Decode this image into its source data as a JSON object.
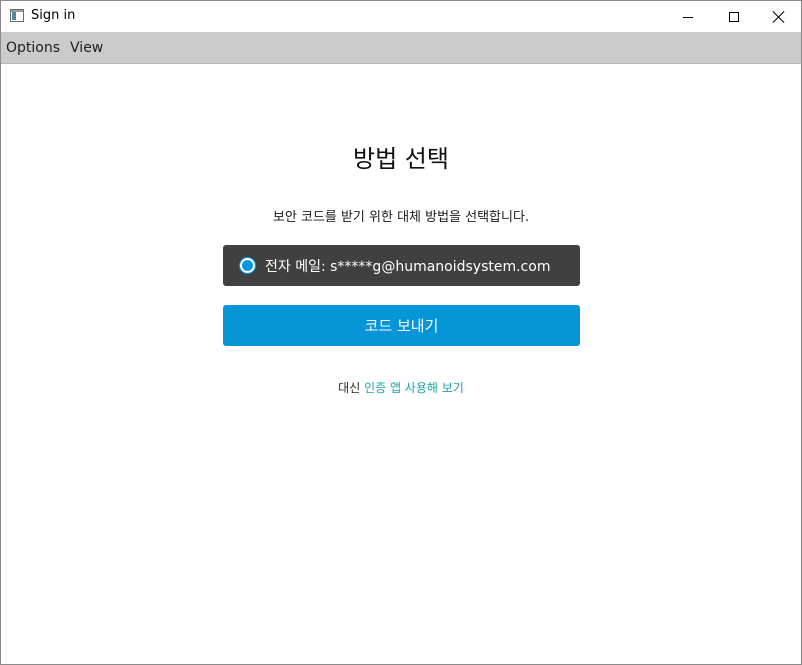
{
  "window": {
    "title": "Sign in",
    "icon": "app-window-icon",
    "controls": [
      "minimize-icon",
      "maximize-icon",
      "close-icon"
    ]
  },
  "menubar": {
    "items": [
      {
        "label": "Options"
      },
      {
        "label": "View"
      }
    ]
  },
  "main": {
    "heading": "방법 선택",
    "subtext": "보안 코드를 받기 위한 대체 방법을 선택합니다.",
    "option": {
      "label": "전자 메일: s*****g@humanoidsystem.com",
      "selected": true
    },
    "send_button": "코드 보내기",
    "alt_prefix": "대신 ",
    "alt_link": "인증 앱 사용해 보기"
  },
  "colors": {
    "menubar_bg": "#cbcbcb",
    "option_bg": "#404040",
    "accent": "#0696d7",
    "link": "#1fa3a3"
  }
}
